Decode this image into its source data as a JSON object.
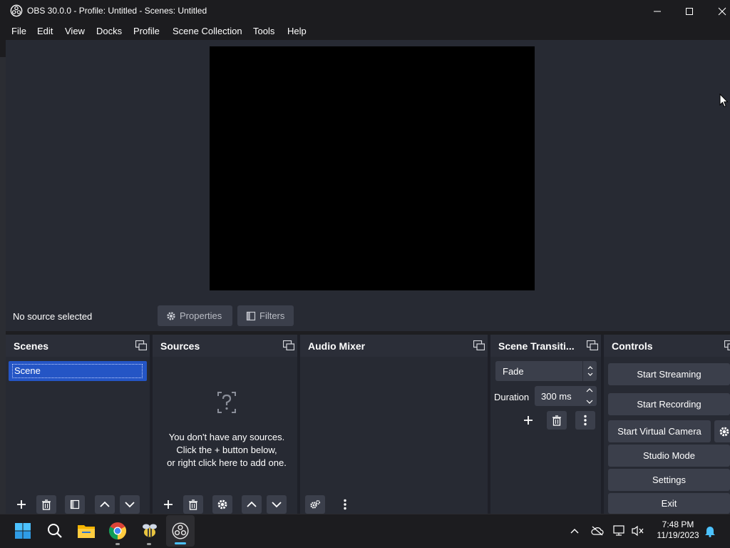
{
  "window": {
    "title": "OBS 30.0.0 - Profile: Untitled - Scenes: Untitled"
  },
  "menu": [
    "File",
    "Edit",
    "View",
    "Docks",
    "Profile",
    "Scene Collection",
    "Tools",
    "Help"
  ],
  "source_bar": {
    "status": "No source selected",
    "properties_label": "Properties",
    "filters_label": "Filters"
  },
  "docks": {
    "scenes": {
      "title": "Scenes",
      "items": [
        "Scene"
      ]
    },
    "sources": {
      "title": "Sources",
      "empty_line1": "You don't have any sources.",
      "empty_line2": "Click the + button below,",
      "empty_line3": "or right click here to add one."
    },
    "audio_mixer": {
      "title": "Audio Mixer"
    },
    "transitions": {
      "title": "Scene Transiti...",
      "selected": "Fade",
      "duration_label": "Duration",
      "duration_value": "300 ms"
    },
    "controls": {
      "title": "Controls",
      "start_streaming": "Start Streaming",
      "start_recording": "Start Recording",
      "start_virtual_camera": "Start Virtual Camera",
      "studio_mode": "Studio Mode",
      "settings": "Settings",
      "exit": "Exit"
    }
  },
  "taskbar": {
    "time": "7:48 PM",
    "date": "11/19/2023",
    "apps": [
      "start-icon",
      "search-icon",
      "file-explorer-icon",
      "chrome-icon",
      "bee-app-icon",
      "obs-icon"
    ]
  },
  "colors": {
    "accent": "#2455c5",
    "panel": "#272a33",
    "button": "#3b3f4b",
    "taskbar": "#1c1c1f"
  }
}
